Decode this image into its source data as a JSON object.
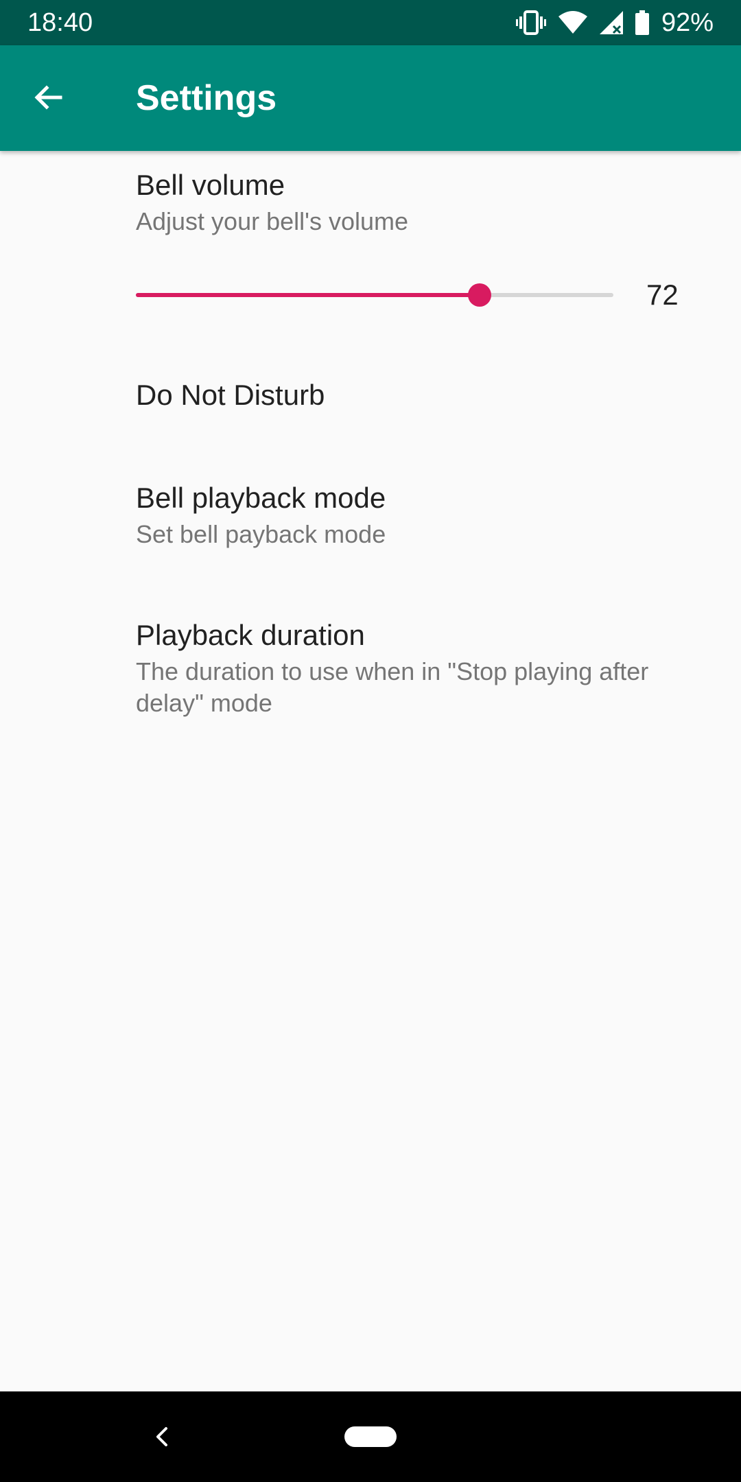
{
  "status_bar": {
    "time": "18:40",
    "battery_percent": "92%",
    "icons": [
      "vibrate-icon",
      "wifi-icon",
      "signal-icon",
      "battery-icon"
    ]
  },
  "app_bar": {
    "back_icon": "arrow-left-icon",
    "title": "Settings"
  },
  "preferences": {
    "bell_volume": {
      "title": "Bell volume",
      "summary": "Adjust your bell's volume",
      "value": 72,
      "value_label": "72",
      "max": 100
    },
    "do_not_disturb": {
      "title": "Do Not Disturb"
    },
    "bell_playback_mode": {
      "title": "Bell playback mode",
      "summary": "Set bell payback mode"
    },
    "playback_duration": {
      "title": "Playback duration",
      "summary": "The duration to use when in \"Stop playing after delay\" mode"
    }
  },
  "nav_bar": {
    "back_icon": "nav-back-icon",
    "home_icon": "nav-home-pill-icon"
  },
  "colors": {
    "status_bar": "#00574d",
    "app_bar": "#00897b",
    "accent": "#d81b60",
    "background": "#fafafa"
  }
}
